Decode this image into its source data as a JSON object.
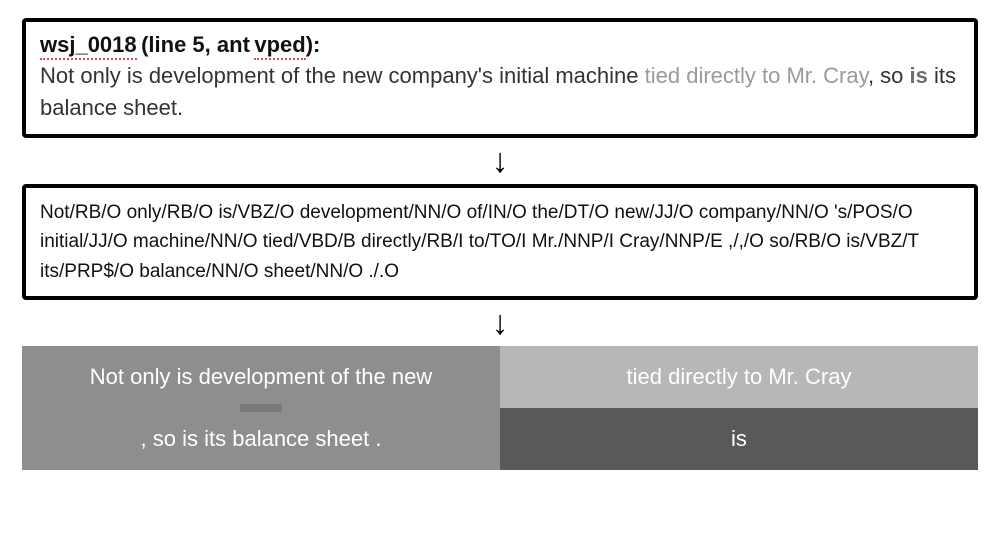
{
  "top": {
    "label_id": "wsj_0018",
    "label_meta1": "(line 5, ant",
    "label_meta2": "vped",
    "label_meta_close": "):",
    "sentence_pre": "Not only is development of the new company's initial machine ",
    "sentence_hl": "tied directly to Mr. Cray",
    "sentence_mid": ", so ",
    "sentence_is": "is",
    "sentence_post": " its balance sheet."
  },
  "arrow": "↓",
  "tagged": "Not/RB/O only/RB/O is/VBZ/O development/NN/O of/IN/O the/DT/O new/JJ/O company/NN/O 's/POS/O initial/JJ/O machine/NN/O tied/VBD/B directly/RB/I to/TO/I Mr./NNP/I Cray/NNP/E ,/,/O so/RB/O is/VBZ/T its/PRP$/O balance/NN/O sheet/NN/O ./.O",
  "grid": {
    "a": "Not only is development of the new",
    "b": "tied directly to Mr. Cray",
    "c": ", so is its balance sheet .",
    "d": "is"
  },
  "colors": {
    "cell_a": "#8e8e8e",
    "cell_b": "#b7b7b7",
    "cell_c": "#8e8e8e",
    "cell_d": "#595959",
    "border": "#000000"
  }
}
